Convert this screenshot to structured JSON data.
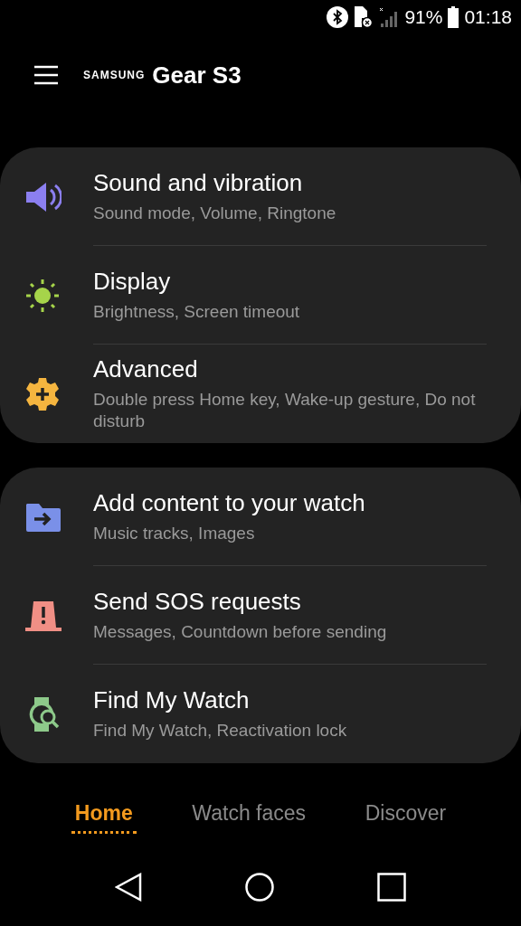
{
  "status_bar": {
    "battery": "91%",
    "time": "01:18"
  },
  "header": {
    "brand": "SAMSUNG",
    "product": "Gear S3"
  },
  "groups": [
    {
      "items": [
        {
          "kind": "sound",
          "color": "#8b7ff0",
          "title": "Sound and vibration",
          "subtitle": "Sound mode, Volume, Ringtone"
        },
        {
          "kind": "display",
          "color": "#a6d44a",
          "title": "Display",
          "subtitle": "Brightness, Screen timeout"
        },
        {
          "kind": "advanced",
          "color": "#f5b53f",
          "title": "Advanced",
          "subtitle": "Double press Home key, Wake-up gesture, Do not disturb"
        }
      ]
    },
    {
      "items": [
        {
          "kind": "content",
          "color": "#7a90e8",
          "title": "Add content to your watch",
          "subtitle": "Music tracks, Images"
        },
        {
          "kind": "sos",
          "color": "#f08f85",
          "title": "Send SOS requests",
          "subtitle": "Messages, Countdown before sending"
        },
        {
          "kind": "find",
          "color": "#8dc98a",
          "title": "Find My Watch",
          "subtitle": "Find My Watch, Reactivation lock"
        }
      ]
    }
  ],
  "tabs": [
    {
      "label": "Home",
      "selected": true
    },
    {
      "label": "Watch faces",
      "selected": false
    },
    {
      "label": "Discover",
      "selected": false
    }
  ]
}
